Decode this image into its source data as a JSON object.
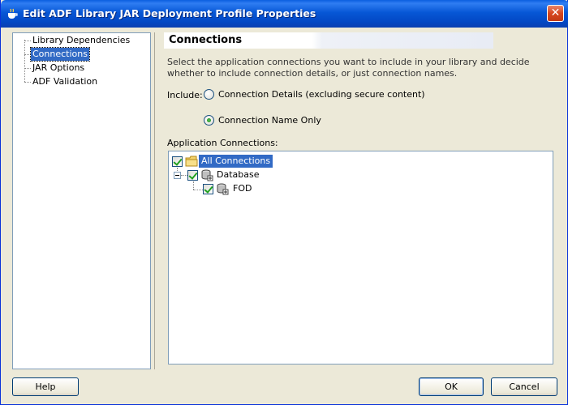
{
  "window": {
    "title": "Edit ADF Library JAR Deployment Profile Properties",
    "close_glyph": "✕"
  },
  "nav": {
    "items": [
      {
        "label": "Library Dependencies",
        "selected": false
      },
      {
        "label": "Connections",
        "selected": true
      },
      {
        "label": "JAR Options",
        "selected": false
      },
      {
        "label": "ADF Validation",
        "selected": false
      }
    ]
  },
  "content": {
    "title": "Connections",
    "description": "Select the application connections you want to include in your library and decide whether to include connection details, or just connection names.",
    "include_label": "Include:",
    "radio_details": {
      "label": "Connection Details (excluding secure content)",
      "checked": false
    },
    "radio_name_only": {
      "label": "Connection Name Only",
      "checked": true
    },
    "app_connections_label": "Application Connections:",
    "tree": {
      "root": {
        "label": "All Connections",
        "checked": true,
        "icon": "folder-icon"
      },
      "database": {
        "label": "Database",
        "checked": true,
        "icon": "database-connection-icon"
      },
      "fod": {
        "label": "FOD",
        "checked": true,
        "icon": "database-connection-icon"
      }
    }
  },
  "buttons": {
    "help": "Help",
    "ok": "OK",
    "cancel": "Cancel"
  },
  "colors": {
    "selection": "#316ac5",
    "title_bar": "#0757d6",
    "dialog_bg": "#ece9d8"
  }
}
